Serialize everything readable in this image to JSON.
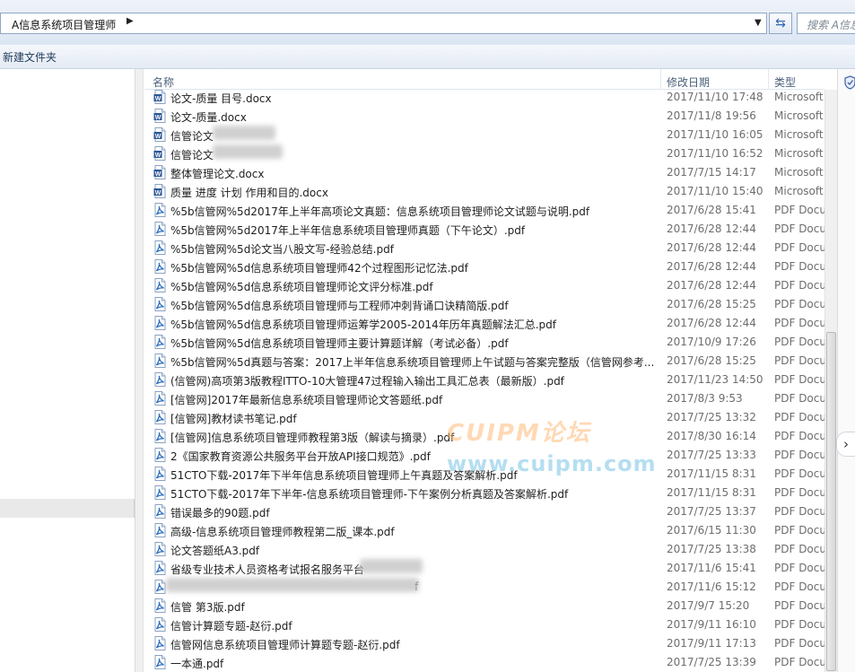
{
  "address": {
    "path": "A信息系统项目管理师",
    "search_placeholder": "搜索 A信息"
  },
  "toolbar": {
    "new_folder": "新建文件夹"
  },
  "columns": {
    "name": "名称",
    "date": "修改日期",
    "type": "类型"
  },
  "watermark": {
    "line1": "CUIPM论坛",
    "line2": "www.cuipm.com"
  },
  "icons": {
    "doc_color": "#2b5797",
    "pdf_color": "#2d6fc0"
  },
  "files": [
    {
      "name": "论文-质量 目号.docx",
      "date": "2017/11/10 17:48",
      "type": "Microsoft",
      "kind": "doc"
    },
    {
      "name": "论文-质量.docx",
      "date": "2017/11/8 19:56",
      "type": "Microsoft",
      "kind": "doc"
    },
    {
      "name": "信管论文",
      "date": "2017/11/10 16:05",
      "type": "Microsoft",
      "kind": "doc"
    },
    {
      "name": "信管论文",
      "date": "2017/11/10 16:52",
      "type": "Microsoft",
      "kind": "doc"
    },
    {
      "name": "整体管理论文.docx",
      "date": "2017/7/15 14:17",
      "type": "Microsoft",
      "kind": "doc"
    },
    {
      "name": "质量 进度 计划 作用和目的.docx",
      "date": "2017/11/10 15:40",
      "type": "Microsoft",
      "kind": "doc"
    },
    {
      "name": "%5b信管网%5d2017年上半年高项论文真题：信息系统项目管理师论文试题与说明.pdf",
      "date": "2017/6/28 15:41",
      "type": "PDF Docu",
      "kind": "pdf"
    },
    {
      "name": "%5b信管网%5d2017年上半年信息系统项目管理师真题（下午论文）.pdf",
      "date": "2017/6/28 12:44",
      "type": "PDF Docu",
      "kind": "pdf"
    },
    {
      "name": "%5b信管网%5d论文当八股文写-经验总结.pdf",
      "date": "2017/6/28 12:44",
      "type": "PDF Docu",
      "kind": "pdf"
    },
    {
      "name": "%5b信管网%5d信息系统项目管理师42个过程图形记忆法.pdf",
      "date": "2017/6/28 12:44",
      "type": "PDF Docu",
      "kind": "pdf"
    },
    {
      "name": "%5b信管网%5d信息系统项目管理师论文评分标准.pdf",
      "date": "2017/6/28 12:44",
      "type": "PDF Docu",
      "kind": "pdf"
    },
    {
      "name": "%5b信管网%5d信息系统项目管理师与工程师冲刺背诵口诀精简版.pdf",
      "date": "2017/6/28 15:25",
      "type": "PDF Docu",
      "kind": "pdf"
    },
    {
      "name": "%5b信管网%5d信息系统项目管理师运筹学2005-2014年历年真题解法汇总.pdf",
      "date": "2017/6/28 12:44",
      "type": "PDF Docu",
      "kind": "pdf"
    },
    {
      "name": "%5b信管网%5d信息系统项目管理师主要计算题详解（考试必备）.pdf",
      "date": "2017/10/9 17:26",
      "type": "PDF Docu",
      "kind": "pdf"
    },
    {
      "name": "%5b信管网%5d真题与答案：2017上半年信息系统项目管理师上午试题与答案完整版（信管网参考...",
      "date": "2017/6/28 15:25",
      "type": "PDF Docu",
      "kind": "pdf"
    },
    {
      "name": "(信管网)高项第3版教程ITTO-10大管理47过程输入输出工具汇总表（最新版）.pdf",
      "date": "2017/11/23 14:50",
      "type": "PDF Docu",
      "kind": "pdf"
    },
    {
      "name": "[信管网]2017年最新信息系统项目管理师论文答题纸.pdf",
      "date": "2017/8/3 9:53",
      "type": "PDF Docu",
      "kind": "pdf"
    },
    {
      "name": "[信管网]教材读书笔记.pdf",
      "date": "2017/7/25 13:32",
      "type": "PDF Docu",
      "kind": "pdf"
    },
    {
      "name": "[信管网]信息系统项目管理师教程第3版（解读与摘录）.pdf",
      "date": "2017/8/30 16:14",
      "type": "PDF Docu",
      "kind": "pdf"
    },
    {
      "name": "2《国家教育资源公共服务平台开放API接口规范》.pdf",
      "date": "2017/7/25 13:33",
      "type": "PDF Docu",
      "kind": "pdf"
    },
    {
      "name": "51CTO下载-2017年下半年信息系统项目管理师上午真题及答案解析.pdf",
      "date": "2017/11/15 8:31",
      "type": "PDF Docu",
      "kind": "pdf"
    },
    {
      "name": "51CTO下载-2017年下半年-信息系统项目管理师-下午案例分析真题及答案解析.pdf",
      "date": "2017/11/15 8:31",
      "type": "PDF Docu",
      "kind": "pdf"
    },
    {
      "name": "错误最多的90题.pdf",
      "date": "2017/7/25 13:37",
      "type": "PDF Docu",
      "kind": "pdf"
    },
    {
      "name": "高级-信息系统项目管理师教程第二版_课本.pdf",
      "date": "2017/6/15 11:30",
      "type": "PDF Docu",
      "kind": "pdf"
    },
    {
      "name": "论文答题纸A3.pdf",
      "date": "2017/7/25 13:38",
      "type": "PDF Docu",
      "kind": "pdf"
    },
    {
      "name": "省级专业技术人员资格考试报名服务平台",
      "date": "2017/11/6 15:41",
      "type": "PDF Docu",
      "kind": "pdf"
    },
    {
      "name": "f",
      "date": "2017/11/6 15:12",
      "type": "PDF Docu",
      "kind": "pdf"
    },
    {
      "name": "信管 第3版.pdf",
      "date": "2017/9/7 15:20",
      "type": "PDF Docu",
      "kind": "pdf"
    },
    {
      "name": "信管计算题专题-赵衍.pdf",
      "date": "2017/9/11 16:10",
      "type": "PDF Docu",
      "kind": "pdf"
    },
    {
      "name": "信管网信息系统项目管理师计算题专题-赵衍.pdf",
      "date": "2017/9/11 17:13",
      "type": "PDF Docu",
      "kind": "pdf"
    },
    {
      "name": "一本通.pdf",
      "date": "2017/7/25 13:39",
      "type": "PDF Docu",
      "kind": "pdf"
    }
  ]
}
